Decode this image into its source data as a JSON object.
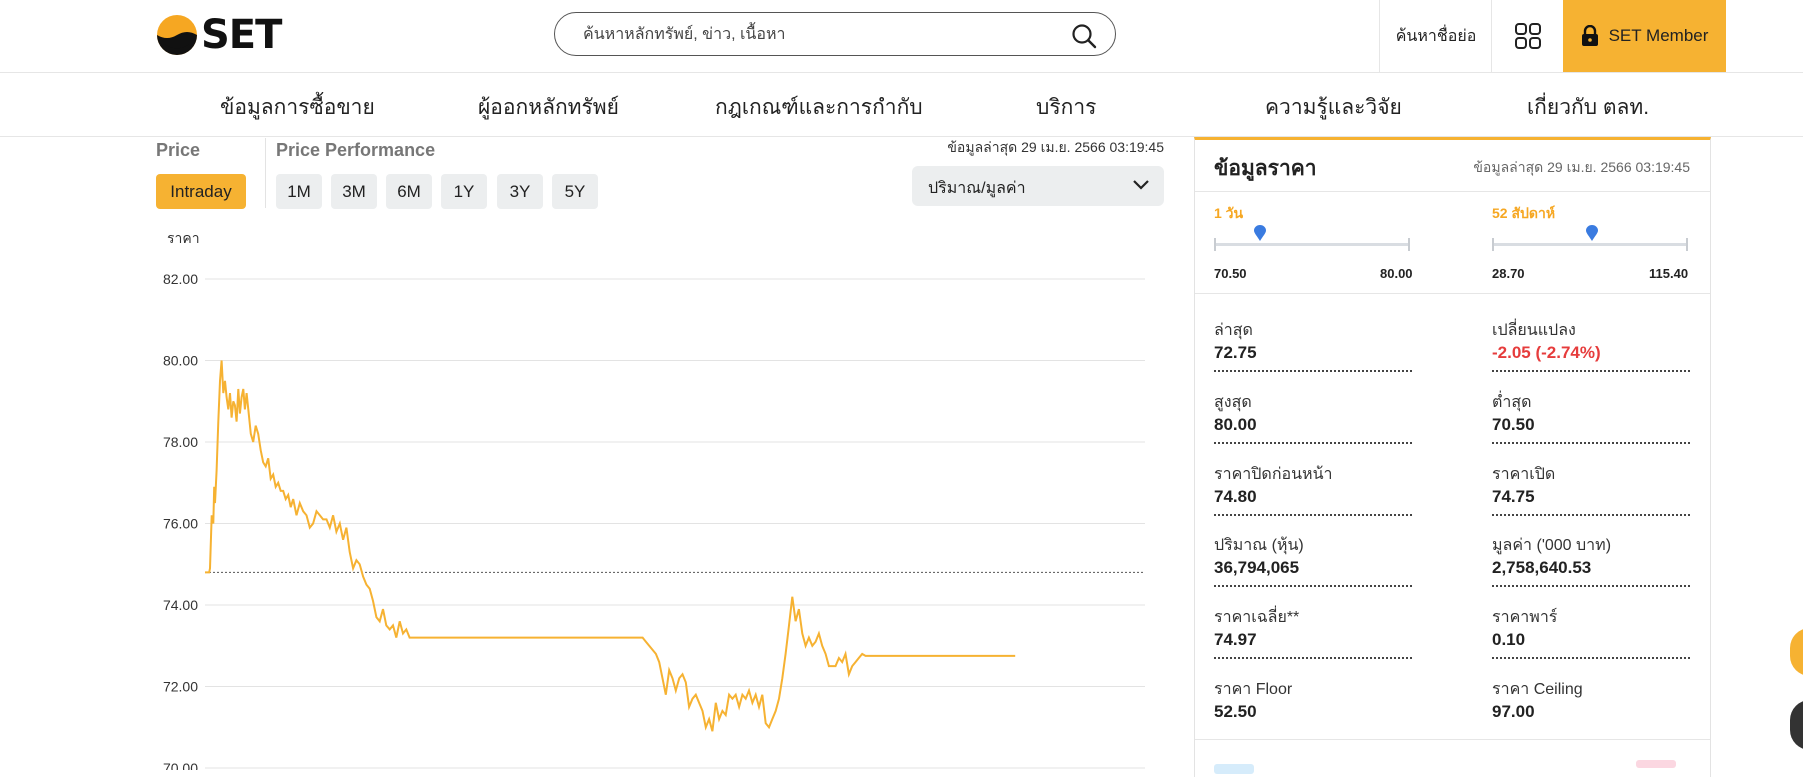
{
  "header": {
    "logo_text": "SET",
    "search_placeholder": "ค้นหาหลักทรัพย์, ข่าว, เนื้อหา",
    "abbr_search_label": "ค้นหาชื่อย่อ",
    "member_label": "SET Member"
  },
  "nav": {
    "items": [
      {
        "label": "ข้อมูลการซื้อขาย"
      },
      {
        "label": "ผู้ออกหลักทรัพย์"
      },
      {
        "label": "กฎเกณฑ์และการกำกับ"
      },
      {
        "label": "บริการ"
      },
      {
        "label": "ความรู้และวิจัย"
      },
      {
        "label": "เกี่ยวกับ ตลท."
      }
    ]
  },
  "chart_section": {
    "price_label": "Price",
    "performance_label": "Price Performance",
    "intraday_label": "Intraday",
    "ranges": [
      "1M",
      "3M",
      "6M",
      "1Y",
      "3Y",
      "5Y"
    ],
    "updated": "ข้อมูลล่าสุด 29 เม.ย. 2566 03:19:45",
    "dropdown_value": "ปริมาณ/มูลค่า",
    "y_axis_label": "ราคา"
  },
  "chart_data": {
    "type": "line",
    "title": "",
    "xlabel": "",
    "ylabel": "ราคา",
    "ylim": [
      70,
      82
    ],
    "yticks": [
      "82.00",
      "80.00",
      "78.00",
      "76.00",
      "74.00",
      "72.00",
      "70.00"
    ],
    "reference_line": {
      "value": 74.8,
      "style": "dotted"
    },
    "grid": true,
    "line_color": "#f6b232",
    "x": [
      0,
      4,
      5,
      6,
      8,
      10,
      11,
      12,
      14,
      16,
      18,
      20,
      22,
      24,
      26,
      28,
      30,
      32,
      34,
      36,
      38,
      40,
      42,
      44,
      46,
      48,
      50,
      52,
      55,
      58,
      61,
      64,
      67,
      70,
      73,
      76,
      79,
      82,
      85,
      88,
      91,
      94,
      97,
      100,
      103,
      106,
      110,
      114,
      118,
      122,
      126,
      130,
      134,
      138,
      142,
      146,
      150,
      154,
      158,
      162,
      166,
      170,
      174,
      178,
      182,
      186,
      190,
      194,
      198,
      202,
      206,
      210,
      214,
      218,
      222,
      226,
      230,
      234,
      238,
      242,
      246,
      250,
      254,
      258,
      262,
      266,
      270,
      274,
      278,
      282,
      286,
      290,
      294,
      298,
      302,
      306,
      310,
      314,
      318,
      322,
      326,
      330,
      334,
      338,
      342,
      346,
      350,
      354,
      358,
      362,
      366,
      370,
      374,
      378,
      382,
      386,
      390,
      394,
      398,
      402,
      406,
      410,
      414,
      418,
      422,
      426,
      430,
      434,
      438,
      442,
      446,
      450,
      454,
      458,
      462,
      466,
      470,
      474,
      478,
      482,
      486,
      490,
      494,
      498,
      502,
      506,
      510,
      514,
      518,
      522,
      526,
      530,
      534,
      538,
      542,
      546,
      550,
      554,
      558,
      562,
      566,
      570,
      574,
      578,
      582,
      586,
      590,
      594,
      598,
      602,
      606,
      610,
      614,
      618,
      622,
      626,
      630,
      634,
      638,
      642,
      646,
      650,
      654,
      658,
      662,
      666,
      670,
      674,
      678,
      682,
      686,
      690,
      694,
      698,
      702,
      706,
      710,
      714,
      718,
      722,
      726,
      730,
      734,
      738,
      742,
      746,
      750,
      754,
      758,
      762,
      766,
      770,
      774,
      778,
      782,
      786,
      790,
      794,
      798,
      802,
      806,
      810,
      814,
      818,
      822,
      826,
      830,
      834,
      838,
      842,
      846,
      850,
      854,
      858,
      862,
      866,
      870,
      874,
      878,
      882,
      886,
      890,
      894,
      898,
      902,
      906,
      910,
      914,
      918,
      922,
      926,
      930,
      934,
      938,
      942,
      946,
      950,
      954,
      958,
      962,
      966,
      970,
      974,
      978,
      982,
      986,
      990,
      994,
      998,
      1002,
      1006,
      1010,
      1014,
      1018,
      1022,
      1026,
      1030,
      1034,
      1038,
      1042,
      1046,
      1050,
      1054,
      1058,
      1062,
      1066,
      1070,
      1074,
      1078,
      1082,
      1086,
      1090,
      1094,
      1098,
      1102,
      1106,
      1110,
      1114,
      1118,
      1122,
      1126,
      1130
    ],
    "values": [
      74.8,
      74.8,
      74.8,
      74.8,
      74.8,
      74.8,
      74.8,
      74.8,
      74.8,
      74.8,
      74.8,
      74.8,
      74.8,
      74.8,
      74.8,
      74.8,
      74.8,
      74.8,
      74.8,
      74.8,
      74.8,
      74.8,
      74.8,
      74.8,
      74.8,
      74.8,
      74.8,
      74.8,
      74.8,
      74.8,
      74.8,
      74.8,
      74.8,
      74.8,
      74.8,
      74.8,
      74.8,
      74.8,
      74.8,
      74.8,
      74.8,
      74.8,
      74.8,
      74.8,
      74.8,
      74.8,
      74.8,
      74.8,
      74.8,
      74.8,
      74.8,
      74.8,
      74.8,
      74.8,
      74.8,
      74.8,
      74.8,
      74.8,
      74.8,
      74.8,
      74.8,
      74.8,
      74.8,
      74.8,
      74.8,
      74.8,
      74.8,
      74.8,
      74.8,
      74.8,
      74.8,
      74.8,
      74.8,
      74.8,
      74.8,
      74.8,
      74.8,
      74.8,
      74.8,
      74.8,
      74.8,
      74.8,
      74.8,
      74.8,
      74.8,
      74.8,
      74.8,
      74.8,
      74.8,
      74.8,
      74.8,
      74.8,
      74.8,
      74.8,
      74.8,
      74.8,
      74.8,
      74.8,
      74.8,
      74.8,
      74.8,
      74.8,
      74.8,
      74.8,
      74.8,
      74.8,
      74.8,
      74.8,
      74.8,
      74.8,
      74.8,
      74.8,
      74.8,
      74.8,
      74.8,
      74.8,
      74.8,
      74.8,
      74.8,
      74.8,
      74.8,
      74.8,
      74.8,
      74.8,
      74.8,
      74.8,
      74.8,
      74.8,
      74.8,
      74.8,
      74.8,
      74.8,
      74.8,
      74.8,
      74.8,
      74.8,
      74.8,
      74.8,
      74.8,
      74.8,
      74.8,
      74.8,
      74.8,
      74.8,
      74.8,
      74.8,
      74.8,
      74.8,
      74.8,
      74.8,
      74.8,
      74.8,
      74.8,
      74.8,
      74.8,
      74.8,
      74.8,
      74.8,
      74.8,
      74.8,
      74.8,
      74.8,
      74.8,
      74.8,
      74.8,
      74.8,
      74.8,
      74.8,
      74.8,
      74.8,
      74.8,
      74.8,
      74.8,
      74.8,
      74.8,
      74.8,
      74.8,
      74.8,
      74.8,
      74.8,
      74.8,
      74.8,
      74.8,
      74.8,
      74.8,
      74.8,
      74.8,
      74.8,
      74.8,
      74.8,
      74.8,
      74.8,
      74.8,
      74.8,
      74.8,
      74.8,
      74.8,
      74.8,
      74.8,
      74.8,
      74.8,
      74.8,
      74.8,
      74.8,
      74.8,
      74.8,
      74.8,
      74.8,
      74.8,
      74.8,
      74.8,
      74.8,
      74.8,
      74.8,
      74.8,
      74.8,
      74.8,
      74.8,
      74.8,
      74.8,
      74.8,
      74.8,
      74.8,
      74.8,
      74.8,
      74.8,
      74.8,
      74.8,
      74.8,
      74.8,
      74.8,
      74.8,
      74.8,
      74.8,
      74.8,
      74.8,
      74.8,
      74.8,
      74.8,
      74.8,
      74.8,
      74.8,
      74.8,
      74.8,
      74.8,
      74.8,
      74.8,
      74.8,
      74.8,
      74.8,
      74.8,
      74.8,
      74.8,
      74.8,
      74.8,
      74.8,
      74.8,
      74.8,
      74.8
    ],
    "series": [
      {
        "values": [
          74.8,
          74.8,
          74.8,
          74.9,
          76.2,
          76.0,
          76.9,
          76.5,
          77.3,
          78.5,
          79.5,
          80.0,
          79.2,
          79.5,
          79.1,
          78.8,
          79.2,
          78.6,
          79.0,
          78.9,
          78.5,
          79.3,
          78.7,
          79.1,
          79.3,
          78.8,
          79.2,
          78.8,
          78.2,
          78.0,
          78.4,
          78.2,
          77.8,
          77.5,
          77.4,
          77.6,
          77.1,
          77.2,
          76.9,
          77.0,
          76.8,
          76.8,
          76.6,
          76.7,
          76.4,
          76.6,
          76.2,
          76.5,
          76.3,
          76.2,
          75.9,
          76.0,
          76.3,
          76.2,
          76.1,
          76.1,
          75.9,
          76.2,
          75.8,
          76.0,
          75.6,
          75.9,
          75.3,
          74.9,
          75.1,
          75.0,
          74.7,
          74.5,
          74.4,
          74.1,
          73.7,
          73.6,
          73.9,
          73.5,
          73.4,
          73.5,
          73.2,
          73.6,
          73.3,
          73.4,
          73.2,
          73.2,
          73.2,
          73.2,
          73.2,
          73.2,
          73.2,
          73.2,
          73.2,
          73.2,
          73.2,
          73.2,
          73.2,
          73.2,
          73.2,
          73.2,
          73.2,
          73.2,
          73.2,
          73.2,
          73.2,
          73.2,
          73.2,
          73.2,
          73.2,
          73.2,
          73.2,
          73.2,
          73.2,
          73.2,
          73.2,
          73.2,
          73.2,
          73.2,
          73.2,
          73.2,
          73.2,
          73.2,
          73.2,
          73.2,
          73.2,
          73.2,
          73.2,
          73.2,
          73.2,
          73.2,
          73.2,
          73.2,
          73.2,
          73.2,
          73.2,
          73.2,
          73.2,
          73.2,
          73.2,
          73.2,
          73.2,
          73.2,
          73.2,
          73.2,
          73.2,
          73.2,
          73.2,
          73.2,
          73.2,
          73.2,
          73.2,
          73.2,
          73.2,
          73.2,
          73.2,
          73.1,
          73.0,
          72.9,
          72.8,
          72.6,
          72.2,
          71.8,
          72.4,
          72.2,
          71.9,
          72.2,
          72.3,
          72.1,
          71.5,
          71.7,
          71.8,
          71.6,
          71.4,
          71.0,
          71.2,
          70.9,
          71.6,
          71.2,
          71.4,
          71.3,
          71.8,
          71.7,
          71.8,
          71.5,
          71.8,
          71.7,
          71.9,
          71.6,
          71.8,
          71.5,
          71.8,
          71.1,
          71.0,
          71.2,
          71.4,
          71.7,
          72.2,
          72.8,
          73.5,
          74.2,
          73.6,
          73.9,
          73.3,
          73.0,
          73.2,
          73.0,
          73.1,
          73.3,
          73.0,
          72.8,
          72.5,
          72.5,
          72.5,
          72.7,
          72.6,
          72.8,
          72.3,
          72.5,
          72.6,
          72.7,
          72.8,
          72.75,
          72.75,
          72.75,
          72.75,
          72.75,
          72.75,
          72.75,
          72.75,
          72.75,
          72.75,
          72.75,
          72.75,
          72.75,
          72.75,
          72.75,
          72.75,
          72.75,
          72.75,
          72.75,
          72.75,
          72.75,
          72.75,
          72.75,
          72.75,
          72.75,
          72.75,
          72.75,
          72.75,
          72.75,
          72.75,
          72.75,
          72.75,
          72.75,
          72.75,
          72.75,
          72.75,
          72.75,
          72.75,
          72.75,
          72.75,
          72.75,
          72.75,
          72.75,
          72.75,
          72.75,
          72.75
        ]
      }
    ]
  },
  "panel": {
    "title": "ข้อมูลราคา",
    "updated": "ข้อมูลล่าสุด 29 เม.ย. 2566 03:19:45",
    "day_range": {
      "label": "1 วัน",
      "low": "70.50",
      "high": "80.00",
      "current": 72.75
    },
    "week52_range": {
      "label": "52 สัปดาห์",
      "low": "28.70",
      "high": "115.40",
      "current": 72.75
    },
    "stats": [
      {
        "label": "ล่าสุด",
        "value": "72.75"
      },
      {
        "label": "เปลี่ยนแปลง",
        "value": "-2.05 (-2.74%)"
      },
      {
        "label": "สูงสุด",
        "value": "80.00"
      },
      {
        "label": "ต่ำสุด",
        "value": "70.50"
      },
      {
        "label": "ราคาปิดก่อนหน้า",
        "value": "74.80"
      },
      {
        "label": "ราคาเปิด",
        "value": "74.75"
      },
      {
        "label": "ปริมาณ (หุ้น)",
        "value": "36,794,065"
      },
      {
        "label": "มูลค่า ('000 บาท)",
        "value": "2,758,640.53"
      },
      {
        "label": "ราคาเฉลี่ย**",
        "value": "74.97"
      },
      {
        "label": "ราคาพาร์",
        "value": "0.10"
      },
      {
        "label": "ราคา Floor",
        "value": "52.50"
      },
      {
        "label": "ราคา Ceiling",
        "value": "97.00"
      }
    ]
  },
  "colors": {
    "accent": "#f6b232",
    "negative": "#e63c3c",
    "pin": "#3a7be0"
  }
}
